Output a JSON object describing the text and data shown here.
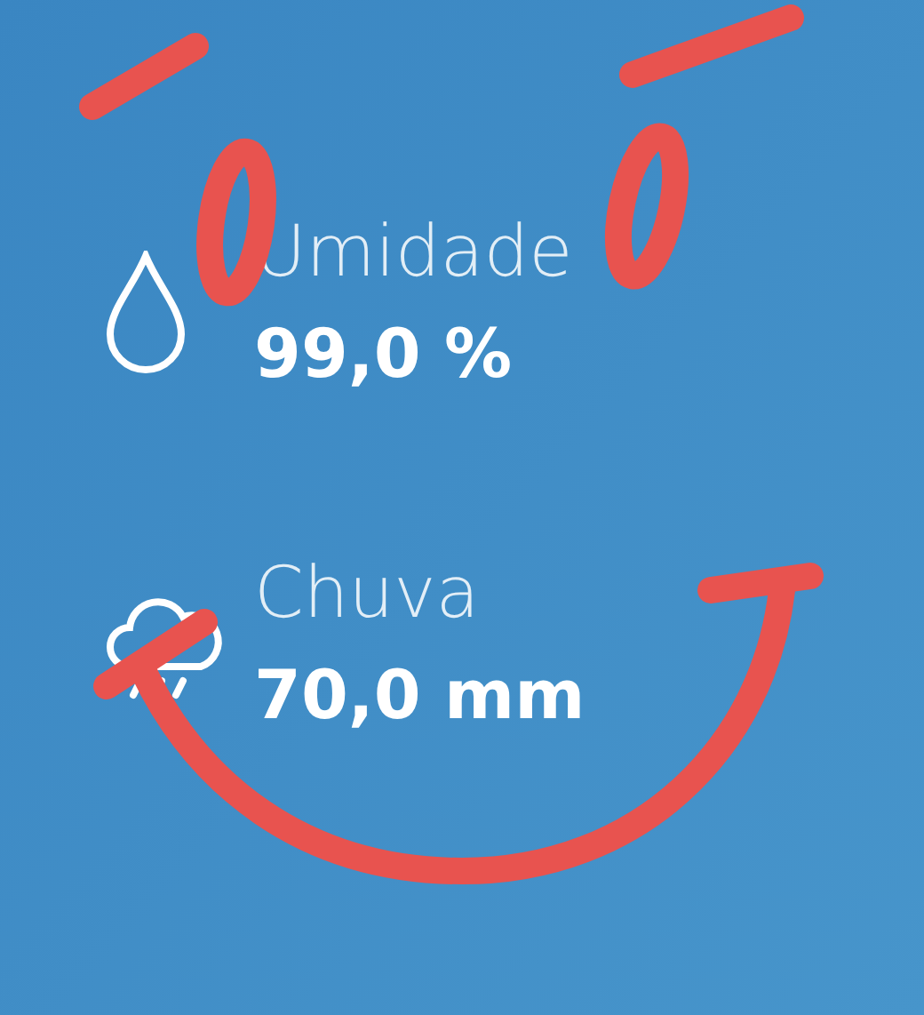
{
  "readings": [
    {
      "kind": "humidity",
      "label": "Umidade",
      "value": "99,0 %"
    },
    {
      "kind": "rain",
      "label": "Chuva",
      "value": "70,0 mm"
    }
  ]
}
